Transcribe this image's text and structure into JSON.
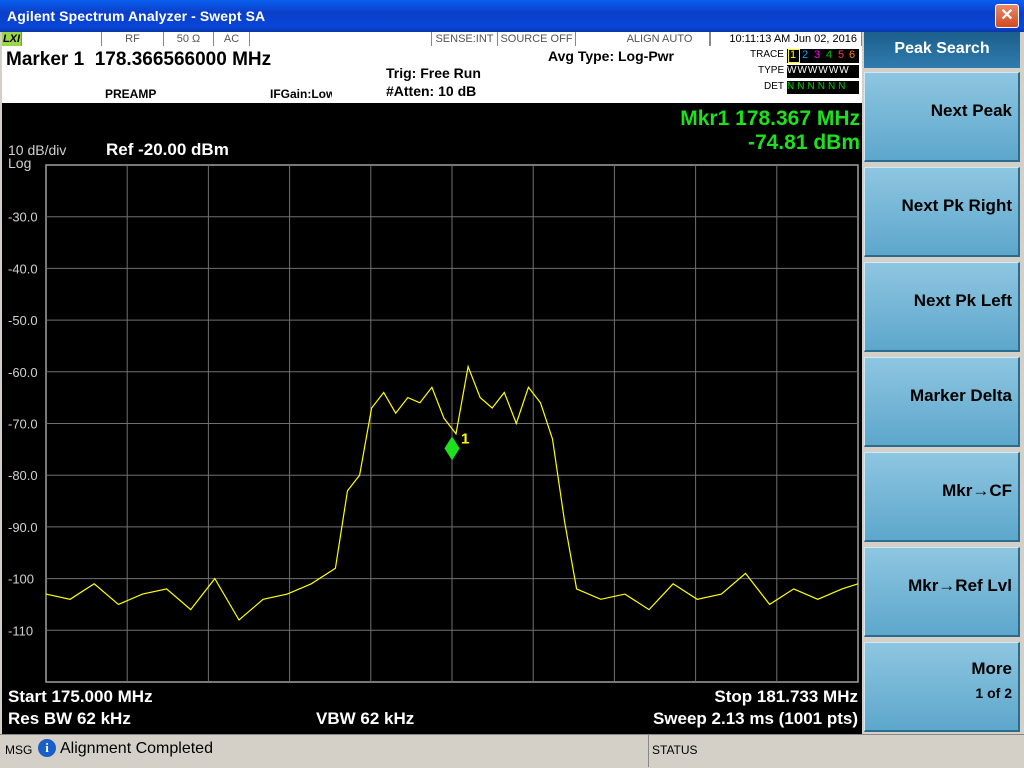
{
  "window": {
    "title": "Agilent Spectrum Analyzer - Swept SA",
    "close_glyph": "✕"
  },
  "status_bar": {
    "lxi": "LXI",
    "rf": "RF",
    "impedance": "50 Ω",
    "coupling": "AC",
    "sense": "SENSE:INT",
    "source": "SOURCE OFF",
    "align": "ALIGN AUTO",
    "datetime": "10:11:13 AM Jun 02, 2016"
  },
  "marker": {
    "label": "Marker 1",
    "freq": "178.366566000 MHz"
  },
  "settings": {
    "preamp": "PREAMP",
    "ifgain": "IFGain:Low",
    "trig": "Trig: Free Run",
    "atten": "#Atten: 10 dB",
    "avg_type": "Avg Type: Log-Pwr",
    "trace_label": "TRACE",
    "type_label": "TYPE",
    "det_label": "DET",
    "trace_nums": [
      "1",
      "2",
      "3",
      "4",
      "5",
      "6"
    ],
    "type_vals": [
      "W",
      "W",
      "W",
      "W",
      "W",
      "W"
    ],
    "det_vals": [
      "N",
      "N",
      "N",
      "N",
      "N",
      "N"
    ],
    "trace_colors": [
      "#ffff00",
      "#00a8ff",
      "#ff00ff",
      "#00c000",
      "#ff4040",
      "#ff8000"
    ]
  },
  "display": {
    "scale": "10 dB/div",
    "log": "Log",
    "ref": "Ref -20.00 dBm",
    "mkr_readout_freq": "Mkr1 178.367 MHz",
    "mkr_readout_amp": "-74.81 dBm",
    "marker_number": "1",
    "start": "Start 175.000 MHz",
    "stop": "Stop 181.733 MHz",
    "rbw": "Res BW 62 kHz",
    "vbw": "VBW 62 kHz",
    "sweep": "Sweep  2.13 ms (1001 pts)"
  },
  "chart_data": {
    "type": "line",
    "title": "",
    "xlabel": "",
    "ylabel": "",
    "xlim": [
      175.0,
      181.733
    ],
    "ylim": [
      -120,
      -20
    ],
    "yticks": [
      "-30.0",
      "-40.0",
      "-50.0",
      "-60.0",
      "-70.0",
      "-80.0",
      "-90.0",
      "-100",
      "-110"
    ],
    "grid": true,
    "series": [
      {
        "color": "#ffff00",
        "x": [
          175.0,
          175.2,
          175.4,
          175.6,
          175.8,
          176.0,
          176.2,
          176.4,
          176.6,
          176.8,
          177.0,
          177.2,
          177.4,
          177.5,
          177.6,
          177.7,
          177.8,
          177.9,
          178.0,
          178.1,
          178.2,
          178.3,
          178.4,
          178.5,
          178.6,
          178.7,
          178.8,
          178.9,
          179.0,
          179.1,
          179.2,
          179.3,
          179.4,
          179.6,
          179.8,
          180.0,
          180.2,
          180.4,
          180.6,
          180.8,
          181.0,
          181.2,
          181.4,
          181.6,
          181.733
        ],
        "y": [
          -103,
          -104,
          -101,
          -105,
          -103,
          -102,
          -106,
          -100,
          -108,
          -104,
          -103,
          -101,
          -98,
          -83,
          -80,
          -67,
          -64,
          -68,
          -65,
          -66,
          -63,
          -69,
          -72,
          -59,
          -65,
          -67,
          -64,
          -70,
          -63,
          -66,
          -73,
          -89,
          -102,
          -104,
          -103,
          -106,
          -101,
          -104,
          -103,
          -99,
          -105,
          -102,
          -104,
          -102,
          -101
        ]
      }
    ],
    "marker": {
      "x": 178.367,
      "y": -74.81,
      "label": "1"
    }
  },
  "softkeys": {
    "title": "Peak Search",
    "items": [
      "Next Peak",
      "Next Pk Right",
      "Next Pk Left",
      "Marker Delta",
      "Mkr→CF",
      "Mkr→Ref Lvl",
      "More"
    ],
    "more_page": "1 of 2"
  },
  "message_bar": {
    "msg_label": "MSG",
    "message": "Alignment Completed",
    "status_label": "STATUS",
    "info_glyph": "i"
  }
}
